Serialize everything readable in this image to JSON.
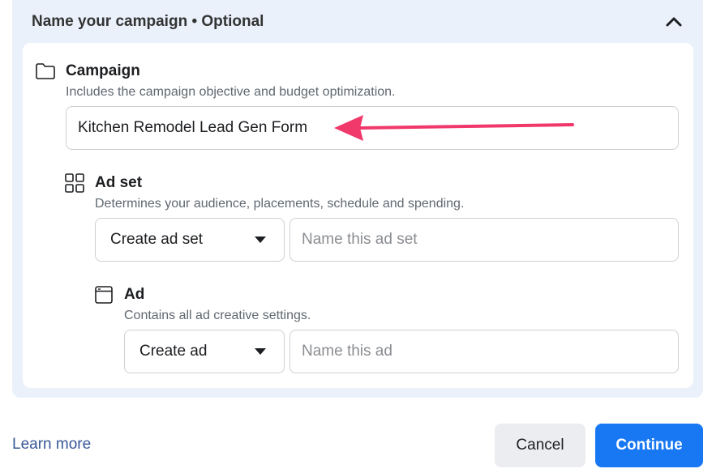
{
  "header": {
    "title": "Name your campaign • Optional"
  },
  "campaign": {
    "title": "Campaign",
    "description": "Includes the campaign objective and budget optimization.",
    "name_value": "Kitchen Remodel Lead Gen Form"
  },
  "adset": {
    "title": "Ad set",
    "description": "Determines your audience, placements, schedule and spending.",
    "select_label": "Create ad set",
    "name_placeholder": "Name this ad set"
  },
  "ad": {
    "title": "Ad",
    "description": "Contains all ad creative settings.",
    "select_label": "Create ad",
    "name_placeholder": "Name this ad"
  },
  "footer": {
    "learn_more": "Learn more",
    "cancel": "Cancel",
    "continue": "Continue"
  },
  "colors": {
    "accent": "#1877f2",
    "annotation_arrow": "#f0386b",
    "link": "#385898"
  }
}
